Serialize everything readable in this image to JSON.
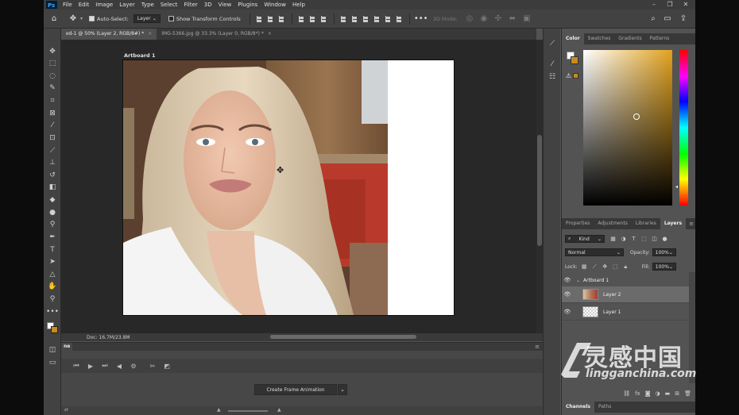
{
  "menu": {
    "items": [
      "File",
      "Edit",
      "Image",
      "Layer",
      "Type",
      "Select",
      "Filter",
      "3D",
      "View",
      "Plugins",
      "Window",
      "Help"
    ]
  },
  "options": {
    "auto_select_label": "Auto-Select:",
    "auto_select_value": "Layer",
    "transform_label": "Show Transform Controls",
    "mode_3d": "3D Mode:"
  },
  "tabs": [
    {
      "label": "ed-1 @ 50% (Layer 2, RGB/8#) *",
      "close": "×"
    },
    {
      "label": "IMG-5366.jpg @ 33.3% (Layer 0, RGB/8*) *",
      "close": "×"
    }
  ],
  "canvas": {
    "artboard_label": "Artboard 1"
  },
  "status": {
    "doc": "Doc: 16.7M/23.8M"
  },
  "timeline": {
    "tab": "ne",
    "create_label": "Create Frame Animation",
    "dropdown": "⌄"
  },
  "color_panel": {
    "tabs": [
      "Color",
      "Swatches",
      "Gradients",
      "Patterns"
    ],
    "active": "Color",
    "fg": "#ffffff",
    "bg": "#c98a1f",
    "hue": "#e2a21e"
  },
  "layers_panel": {
    "tabs": [
      "Properties",
      "Adjustments",
      "Libraries",
      "Layers"
    ],
    "active": "Layers",
    "kind_label": "Kind",
    "blend_mode": "Normal",
    "opacity_label": "Opacity:",
    "opacity_value": "100%",
    "lock_label": "Lock:",
    "fill_label": "Fill:",
    "fill_value": "100%",
    "layers": [
      {
        "name": "Artboard 1",
        "type": "group"
      },
      {
        "name": "Layer 2",
        "type": "photo",
        "selected": true
      },
      {
        "name": "Layer 1",
        "type": "blank"
      }
    ]
  },
  "bottom_tabs": [
    "Channels",
    "Paths"
  ],
  "watermark": {
    "cn": "灵感中国",
    "en": "lingganchina.com"
  }
}
